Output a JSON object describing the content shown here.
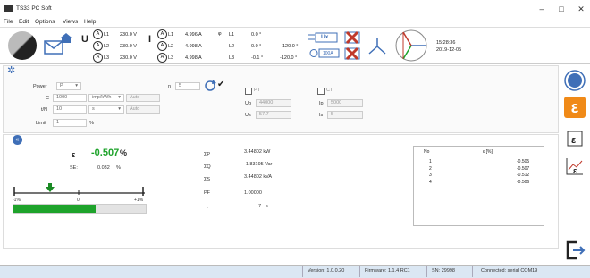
{
  "app": {
    "title": "TS33 PC Soft"
  },
  "menu": [
    "File",
    "Edit",
    "Options",
    "Views",
    "Help"
  ],
  "window_controls": {
    "minimize": "–",
    "maximize": "□",
    "close": "✕"
  },
  "toolbar": {
    "u_label": "U",
    "i_label": "I",
    "voltage": [
      {
        "phase": "L1",
        "value": "230.0 V"
      },
      {
        "phase": "L2",
        "value": "230.0 V"
      },
      {
        "phase": "L3",
        "value": "230.0 V"
      }
    ],
    "current": [
      {
        "phase": "L1",
        "value": "4.996 A"
      },
      {
        "phase": "L2",
        "value": "4.998 A"
      },
      {
        "phase": "L3",
        "value": "4.998 A"
      }
    ],
    "phi_symbol": "φ",
    "phase_angles": [
      {
        "phase": "L1",
        "angle": "0.0 °",
        "between": ""
      },
      {
        "phase": "L2",
        "angle": "0.0 °",
        "between": "120.0 °"
      },
      {
        "phase": "L3",
        "angle": "-0.1 °",
        "between": "-120.0 °"
      }
    ],
    "ux_label": "Ux",
    "range_label": "100A",
    "time": "15:28:36",
    "date": "2019-12-05"
  },
  "settings": {
    "power_label": "Power",
    "power_value": "P",
    "c_label": "C",
    "c_value": "1000",
    "c_unit": "imp/kWh",
    "auto1": "Auto",
    "tn_label": "t/N",
    "tn_value": "10",
    "tn_unit": "s",
    "auto2": "Auto",
    "limit_label": "Limit",
    "limit_value": "1",
    "limit_unit": "%",
    "n_label": "n",
    "n_value": "5",
    "pt_label": "PT",
    "up_label": "Up",
    "up_value": "44000",
    "us_label": "Us",
    "us_value": "57.7",
    "ct_label": "CT",
    "ip_label": "Ip",
    "ip_value": "5000",
    "is_label": "Is",
    "is_value": "5"
  },
  "results": {
    "epsilon_label": "ε",
    "epsilon_value": "-0.507",
    "epsilon_unit": "%",
    "se_label": "SE:",
    "se_value": "0.032",
    "se_unit": "%",
    "sum_p_label": "ΣP",
    "sum_p_value": "3.44802 kW",
    "sum_q_label": "ΣQ",
    "sum_q_value": "-1.83195 Var",
    "sum_s_label": "ΣS",
    "sum_s_value": "3.44802 kVA",
    "pf_label": "PF",
    "pf_value": "1.00000",
    "t_label": "t",
    "t_value": "7",
    "t_unit": "s",
    "scale_min": "-1%",
    "scale_mid": "0",
    "scale_max": "+1%",
    "progress": 0.62
  },
  "table": {
    "headers": [
      "No",
      "ε [%]"
    ],
    "rows": [
      [
        "1",
        "-0.505"
      ],
      [
        "2",
        "-0.507"
      ],
      [
        "3",
        "-0.512"
      ],
      [
        "4",
        "-0.506"
      ]
    ]
  },
  "status": {
    "version": "Version: 1.0.0.20",
    "firmware": "Firmware: 1.1.4 RC1",
    "sn": "SN: 29998",
    "connection": "Connected: serial COM19"
  },
  "colors": {
    "accent": "#3f6fb7",
    "orange": "#f08a18",
    "green": "#1ea32b",
    "red": "#c0392b"
  }
}
